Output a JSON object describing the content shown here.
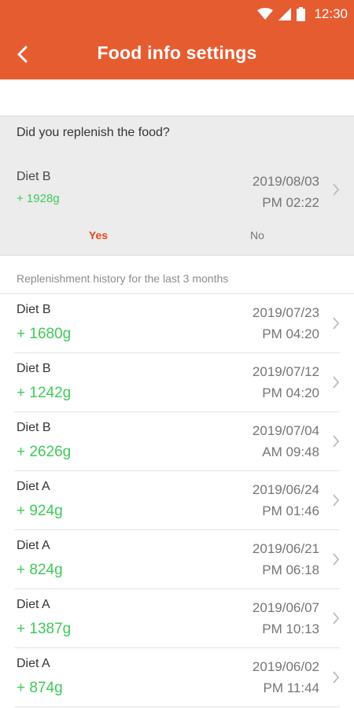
{
  "status_bar": {
    "time": "12:30"
  },
  "header": {
    "title": "Food info settings"
  },
  "question": {
    "text": "Did you replenish the food?",
    "entry": {
      "name": "Diet B",
      "amount": "+ 1928g",
      "date": "2019/08/03",
      "time": "PM 02:22"
    },
    "yes_label": "Yes",
    "no_label": "No"
  },
  "history": {
    "caption": "Replenishment history for the last 3 months",
    "items": [
      {
        "name": "Diet B",
        "amount": "+ 1680g",
        "date": "2019/07/23",
        "time": "PM 04:20"
      },
      {
        "name": "Diet B",
        "amount": "+ 1242g",
        "date": "2019/07/12",
        "time": "PM 04:20"
      },
      {
        "name": "Diet B",
        "amount": "+ 2626g",
        "date": "2019/07/04",
        "time": "AM 09:48"
      },
      {
        "name": "Diet A",
        "amount": "+ 924g",
        "date": "2019/06/24",
        "time": "PM 01:46"
      },
      {
        "name": "Diet A",
        "amount": "+ 824g",
        "date": "2019/06/21",
        "time": "PM 06:18"
      },
      {
        "name": "Diet A",
        "amount": "+ 1387g",
        "date": "2019/06/07",
        "time": "PM 10:13"
      },
      {
        "name": "Diet A",
        "amount": "+ 874g",
        "date": "2019/06/02",
        "time": "PM 11:44"
      }
    ]
  },
  "colors": {
    "accent": "#e65c31",
    "positive": "#3fca58",
    "selected": "#e04a21"
  }
}
